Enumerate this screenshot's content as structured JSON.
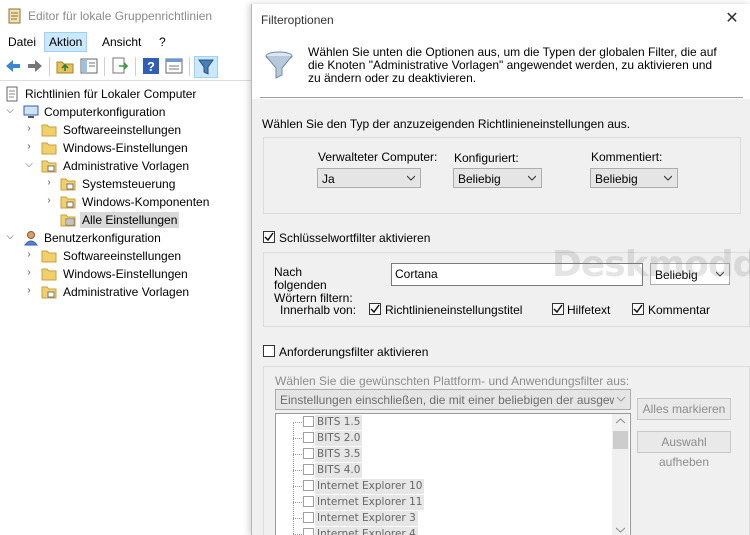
{
  "main_window": {
    "title": "Editor für lokale Gruppenrichtlinien",
    "menu": [
      "Datei",
      "Aktion",
      "Ansicht",
      "?"
    ],
    "active_menu": "Aktion",
    "toolbar_icons": [
      "back-arrow-icon",
      "forward-arrow-icon",
      "folder-up-icon",
      "show-hide-tree-icon",
      "export-list-icon",
      "help-icon",
      "properties-icon",
      "filter-icon"
    ]
  },
  "tree": {
    "root": "Richtlinien für Lokaler Computer",
    "computer": "Computerkonfiguration",
    "computer_children": [
      "Softwareeinstellungen",
      "Windows-Einstellungen",
      "Administrative Vorlagen"
    ],
    "admin_children": [
      "Systemsteuerung",
      "Windows-Komponenten",
      "Alle Einstellungen"
    ],
    "user": "Benutzerkonfiguration",
    "user_children": [
      "Softwareeinstellungen",
      "Windows-Einstellungen",
      "Administrative Vorlagen"
    ]
  },
  "dialog": {
    "title": "Filteroptionen",
    "close_glyph": "✕",
    "intro": "Wählen Sie unten die Optionen aus, um die Typen der globalen Filter, die auf die Knoten \"Administrative Vorlagen\" angewendet werden, zu aktivieren und zu ändern oder zu deaktivieren.",
    "type_prompt": "Wählen Sie den Typ der anzuzeigenden Richtlinieneinstellungen aus.",
    "managed_label": "Verwalteter Computer:",
    "managed_value": "Ja",
    "configured_label": "Konfiguriert:",
    "configured_value": "Beliebig",
    "commented_label": "Kommentiert:",
    "commented_value": "Beliebig",
    "keyword_enable": "Schlüsselwortfilter aktivieren",
    "keyword_enabled": true,
    "keyword_label": "Nach folgenden Wörtern filtern:",
    "keyword_value": "Cortana",
    "keyword_mode": "Beliebig",
    "within_label": "Innerhalb von:",
    "within_title": "Richtlinieneinstellungstitel",
    "within_help": "Hilfetext",
    "within_comment": "Kommentar",
    "req_enable": "Anforderungsfilter aktivieren",
    "req_enabled": false,
    "platform_prompt": "Wählen Sie die gewünschten Plattform- und Anwendungsfilter aus:",
    "platform_combo": "Einstellungen einschließen, die mit einer beliebigen der ausgewählten Plattformen übereinstimmen",
    "select_all": "Alles markieren",
    "clear_all": "Auswahl aufheben",
    "platforms": [
      "BITS 1.5",
      "BITS 2.0",
      "BITS 3.5",
      "BITS 4.0",
      "Internet Explorer 10",
      "Internet Explorer 11",
      "Internet Explorer 3",
      "Internet Explorer 4"
    ]
  },
  "watermark": "Deskmodder.de"
}
